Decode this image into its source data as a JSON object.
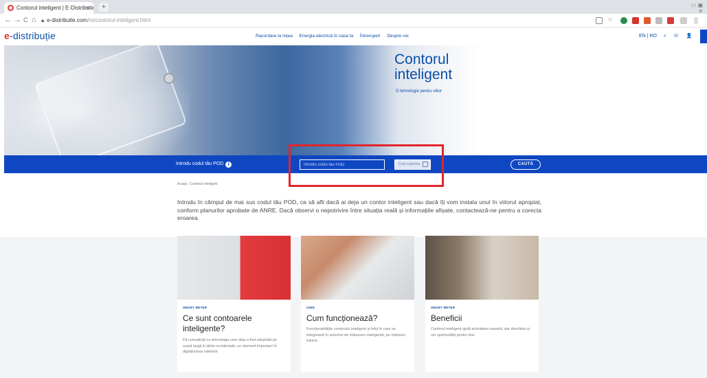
{
  "browser": {
    "tab_title": "Contorul inteligent | E-Distributie",
    "tab_close": "×",
    "new_tab": "+",
    "window_controls": "▭ ▣ ✕",
    "back": "←",
    "forward": "→",
    "reload": "C",
    "home": "⌂",
    "url_host": "e-distributie.com",
    "url_path": "/ro/contorul-inteligent.html"
  },
  "site": {
    "logo_mark": "e",
    "logo_text": "-distribuție",
    "nav": [
      "Racordare la rețea",
      "Energia electrică în casa ta",
      "Întreruperi",
      "Despre noi"
    ],
    "util": [
      "EN | RO",
      "⌕",
      "☏",
      "👤"
    ]
  },
  "hero": {
    "title_line1": "Contorul",
    "title_line2": "inteligent",
    "subtitle": "O tehnologie pentru viitor"
  },
  "search": {
    "label": "Introdu codul tău POD",
    "info": "i",
    "placeholder": "Introdu codul tău POD",
    "captcha_placeholder": "Cod captcha",
    "button": "CAUTĂ"
  },
  "breadcrumb": "Acasă  ›  Contorul inteligent",
  "intro": "Introdu în câmpul de mai sus codul tău POD, ca să afli dacă ai deja un contor inteligent sau dacă îți vom instala unul în viitorul apropiat, conform planurilor aprobate de ANRE. Dacă observi o nepotrivire între situația reală și informațiile afișate, contactează-ne pentru a corecta eroarea.",
  "cards": [
    {
      "tag": "SMART METER",
      "title": "Ce sunt contoarele inteligente?",
      "desc": "Fă cunoștință cu tehnologia care deja a fost adoptată pe scară largă în țările occidentale, un element important în digitalizarea rețelelor."
    },
    {
      "tag": "GHID",
      "title": "Cum funcționează?",
      "desc": "Funcționalitățile contorului inteligent și felul în care se integrează în sistemul de măsurare inteligentă, pe înțelesul tuturor."
    },
    {
      "tag": "SMART METER",
      "title": "Beneficii",
      "desc": "Contorul inteligent ajută activitatea noastră, dar deschide și noi oportunități pentru tine."
    }
  ],
  "colors": {
    "brand_blue": "#0f47c3",
    "brand_text_blue": "#0a4ea8",
    "brand_red": "#e0312f",
    "highlight_red": "#e3242b"
  }
}
